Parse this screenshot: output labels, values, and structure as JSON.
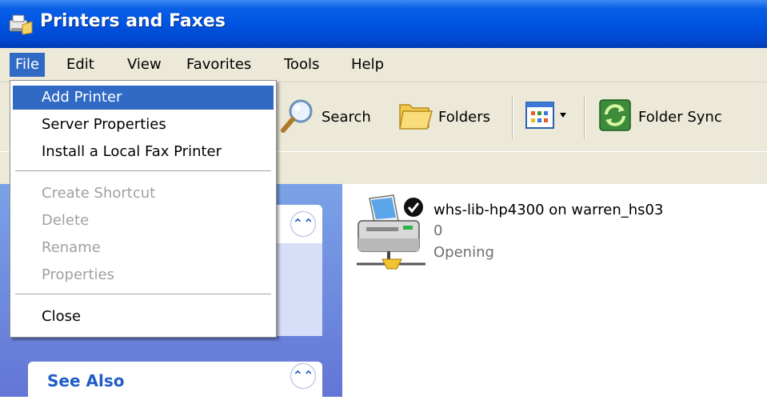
{
  "window": {
    "title": "Printers and Faxes"
  },
  "menubar": {
    "items": [
      {
        "label": "File",
        "active": true
      },
      {
        "label": "Edit"
      },
      {
        "label": "View"
      },
      {
        "label": "Favorites"
      },
      {
        "label": "Tools"
      },
      {
        "label": "Help"
      }
    ]
  },
  "file_menu": {
    "add_printer": "Add Printer",
    "server_properties": "Server Properties",
    "install_fax": "Install a Local Fax Printer",
    "create_shortcut": "Create Shortcut",
    "delete": "Delete",
    "rename": "Rename",
    "properties": "Properties",
    "close": "Close"
  },
  "toolbar": {
    "search_label": "Search",
    "folders_label": "Folders",
    "folder_sync_label": "Folder Sync"
  },
  "taskpane": {
    "see_also_title": "See Also"
  },
  "printer": {
    "name": "whs-lib-hp4300 on warren_hs03",
    "documents": "0",
    "status": "Opening"
  },
  "icons": {
    "title": "printer-folder-icon",
    "search": "search-icon",
    "folders": "folders-icon",
    "views": "views-icon",
    "sync": "folder-sync-icon",
    "printer": "network-printer-icon",
    "default_check": "default-printer-check-icon",
    "collapse": "chevron-up-icon"
  },
  "colors": {
    "titlebar": "#0054e3",
    "highlight": "#316ac5",
    "menubar": "#ece9d8",
    "taskpane_link": "#215dc6"
  }
}
